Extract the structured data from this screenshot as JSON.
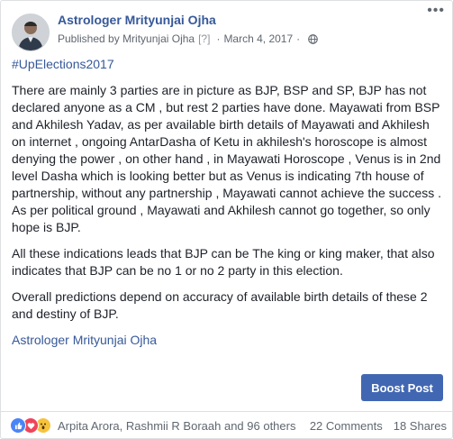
{
  "post": {
    "page_name": "Astrologer Mrityunjai Ojha",
    "published_prefix": "Published by",
    "author": "Mrityunjai Ojha",
    "help_marker": "[?]",
    "separator": "·",
    "date": "March 4, 2017",
    "privacy_icon": "globe-icon",
    "more_icon": "ellipsis-icon",
    "hashtag": "#UpElections2017",
    "paragraphs": [
      "There are mainly 3 parties are in picture as BJP, BSP and SP, BJP has not declared anyone as a CM , but rest 2 parties have done. Mayawati from BSP and Akhilesh Yadav, as per available birth details of Mayawati and Akhilesh on internet , ongoing AntarDasha of Ketu in akhilesh's horoscope is almost denying the power , on other hand , in Mayawati Horoscope , Venus is in 2nd level Dasha which is looking better but as Venus is indicating 7th house of partnership, without any partnership , Mayawati cannot achieve the success . As per political ground , Mayawati and Akhilesh cannot go together, so only hope is BJP.",
      "All these indications leads that BJP can be The king or king maker, that also indicates that BJP can be no 1 or no 2 party in this election.",
      "Overall predictions depend on accuracy of available birth details of these 2 and destiny of BJP."
    ],
    "signature": "Astrologer Mrityunjai Ojha"
  },
  "actions": {
    "boost_label": "Boost Post"
  },
  "footer": {
    "reaction_icons": [
      "like-icon",
      "love-icon",
      "wow-icon"
    ],
    "reaction_names": "Arpita Arora, Rashmii R Boraah and 96 others",
    "comments": "22 Comments",
    "shares": "18 Shares"
  },
  "colors": {
    "link": "#365899",
    "boost_bg": "#4267b2",
    "like": "#4b84f5",
    "love": "#f0445a",
    "wow": "#f7c33c"
  }
}
